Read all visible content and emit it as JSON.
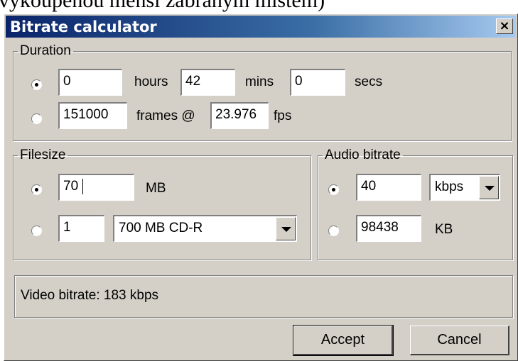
{
  "background_text": "vykoupenou menší zabraným místem)",
  "window": {
    "title": "Bitrate calculator",
    "close_label": "×"
  },
  "duration": {
    "legend": "Duration",
    "hours_value": "0",
    "hours_label": "hours",
    "mins_value": "42",
    "mins_label": "mins",
    "secs_value": "0",
    "secs_label": "secs",
    "frames_value": "151000",
    "frames_label": "frames @",
    "fps_value": "23.976",
    "fps_label": "fps",
    "selected": "time"
  },
  "filesize": {
    "legend": "Filesize",
    "size_value": "70",
    "size_unit": "MB",
    "count_value": "1",
    "media_selected": "700 MB CD-R",
    "selected": "size"
  },
  "audio": {
    "legend": "Audio bitrate",
    "bitrate_value": "40",
    "bitrate_unit_selected": "kbps",
    "size_value": "98438",
    "size_unit": "KB",
    "selected": "bitrate"
  },
  "result": {
    "text": "Video bitrate: 183 kbps"
  },
  "buttons": {
    "accept": "Accept",
    "cancel": "Cancel"
  },
  "colors": {
    "face": "#d4d0c8",
    "title_start": "#0a246a",
    "title_end": "#a6caf0"
  }
}
